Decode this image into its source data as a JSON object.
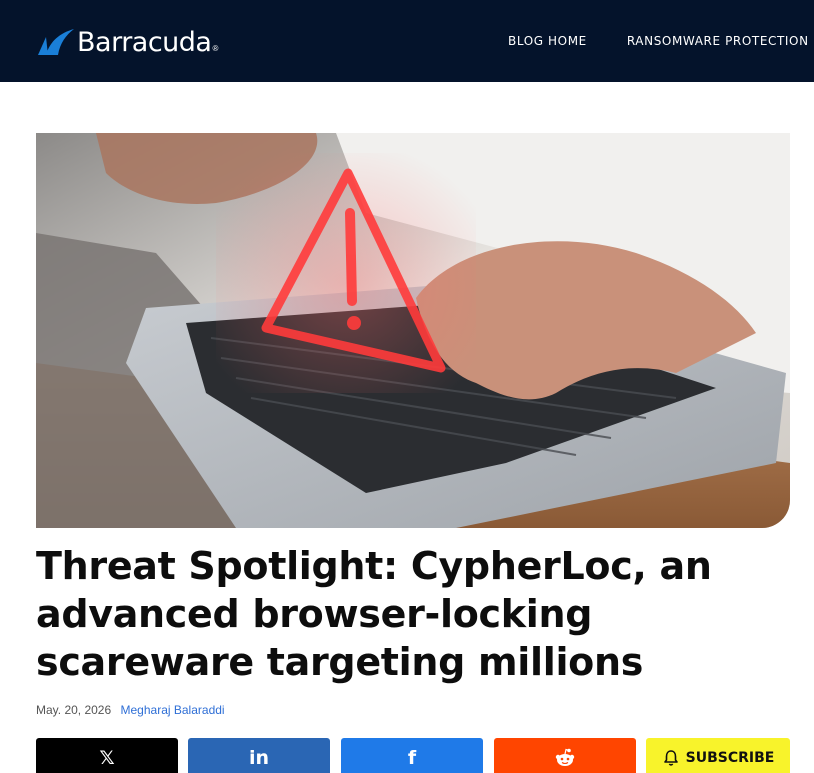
{
  "header": {
    "brand": "Barracuda",
    "brand_mark": "®",
    "nav": [
      "BLOG HOME",
      "RANSOMWARE PROTECTION"
    ]
  },
  "hero": {
    "icon": "warning-triangle-icon",
    "accent": "#ff3b3b"
  },
  "article": {
    "title": "Threat Spotlight: CypherLoc, an advanced browser-locking scareware targeting millions",
    "date": "May. 20, 2026",
    "author": "Megharaj Balaraddi"
  },
  "share": {
    "x_glyph": "𝕏",
    "linkedin_glyph": "in",
    "facebook_glyph": "f",
    "reddit_icon": "reddit-icon",
    "subscribe_label": "SUBSCRIBE",
    "colors": {
      "x": "#000000",
      "linkedin": "#2a66b4",
      "facebook": "#1f7ae8",
      "reddit": "#ff4500",
      "subscribe": "#f8f32b"
    }
  },
  "colors": {
    "header_bg": "#04132b",
    "link": "#2f6fd6"
  }
}
